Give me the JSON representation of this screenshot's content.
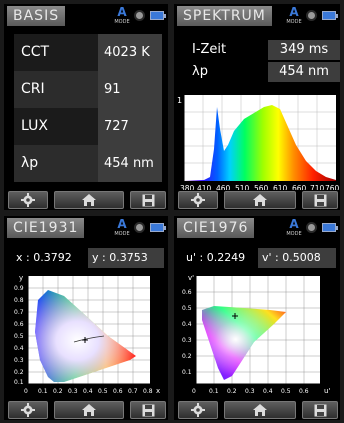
{
  "basis": {
    "title": "BASIS",
    "rows": [
      {
        "label": "CCT",
        "value": "4023 K"
      },
      {
        "label": "CRI",
        "value": "91"
      },
      {
        "label": "LUX",
        "value": "727"
      },
      {
        "label": "λp",
        "value": "454 nm"
      }
    ]
  },
  "spektrum": {
    "title": "SPEKTRUM",
    "rows": [
      {
        "label": "I-Zeit",
        "value": "349 ms"
      },
      {
        "label": "λp",
        "value": "454 nm"
      }
    ],
    "y_tick": "1",
    "x_ticks": [
      "380",
      "410",
      "460",
      "510",
      "560",
      "610",
      "660",
      "710",
      "760"
    ]
  },
  "cie1931": {
    "title": "CIE1931",
    "x_label": "x : 0.3792",
    "y_label": "y : 0.3753",
    "axis_y": "y",
    "axis_x": "x",
    "y_ticks": [
      "0.9",
      "0.8",
      "0.7",
      "0.6",
      "0.5",
      "0.4",
      "0.3",
      "0.2",
      "0.1",
      "0"
    ],
    "x_ticks": [
      "0.1",
      "0.2",
      "0.3",
      "0.4",
      "0.5",
      "0.6",
      "0.7",
      "0.8"
    ]
  },
  "cie1976": {
    "title": "CIE1976",
    "x_label": "u' : 0.2249",
    "y_label": "v' : 0.5008",
    "axis_y": "v'",
    "axis_x": "u'",
    "y_ticks": [
      "0.6",
      "0.5",
      "0.4",
      "0.3",
      "0.2",
      "0.1",
      "0"
    ],
    "x_ticks": [
      "0.1",
      "0.2",
      "0.3",
      "0.4",
      "0.5",
      "0.6"
    ]
  },
  "header_icons": {
    "mode_letter": "A",
    "mode_text": "MODE",
    "icons": [
      "mode-icon",
      "record-dot-icon",
      "battery-icon"
    ]
  },
  "footer_icons": [
    "gear-icon",
    "home-icon",
    "save-icon"
  ],
  "colors": {
    "header_bg": "#6f6f6f",
    "value_bg": "#3d3d3d",
    "accent": "#3a78d8"
  }
}
